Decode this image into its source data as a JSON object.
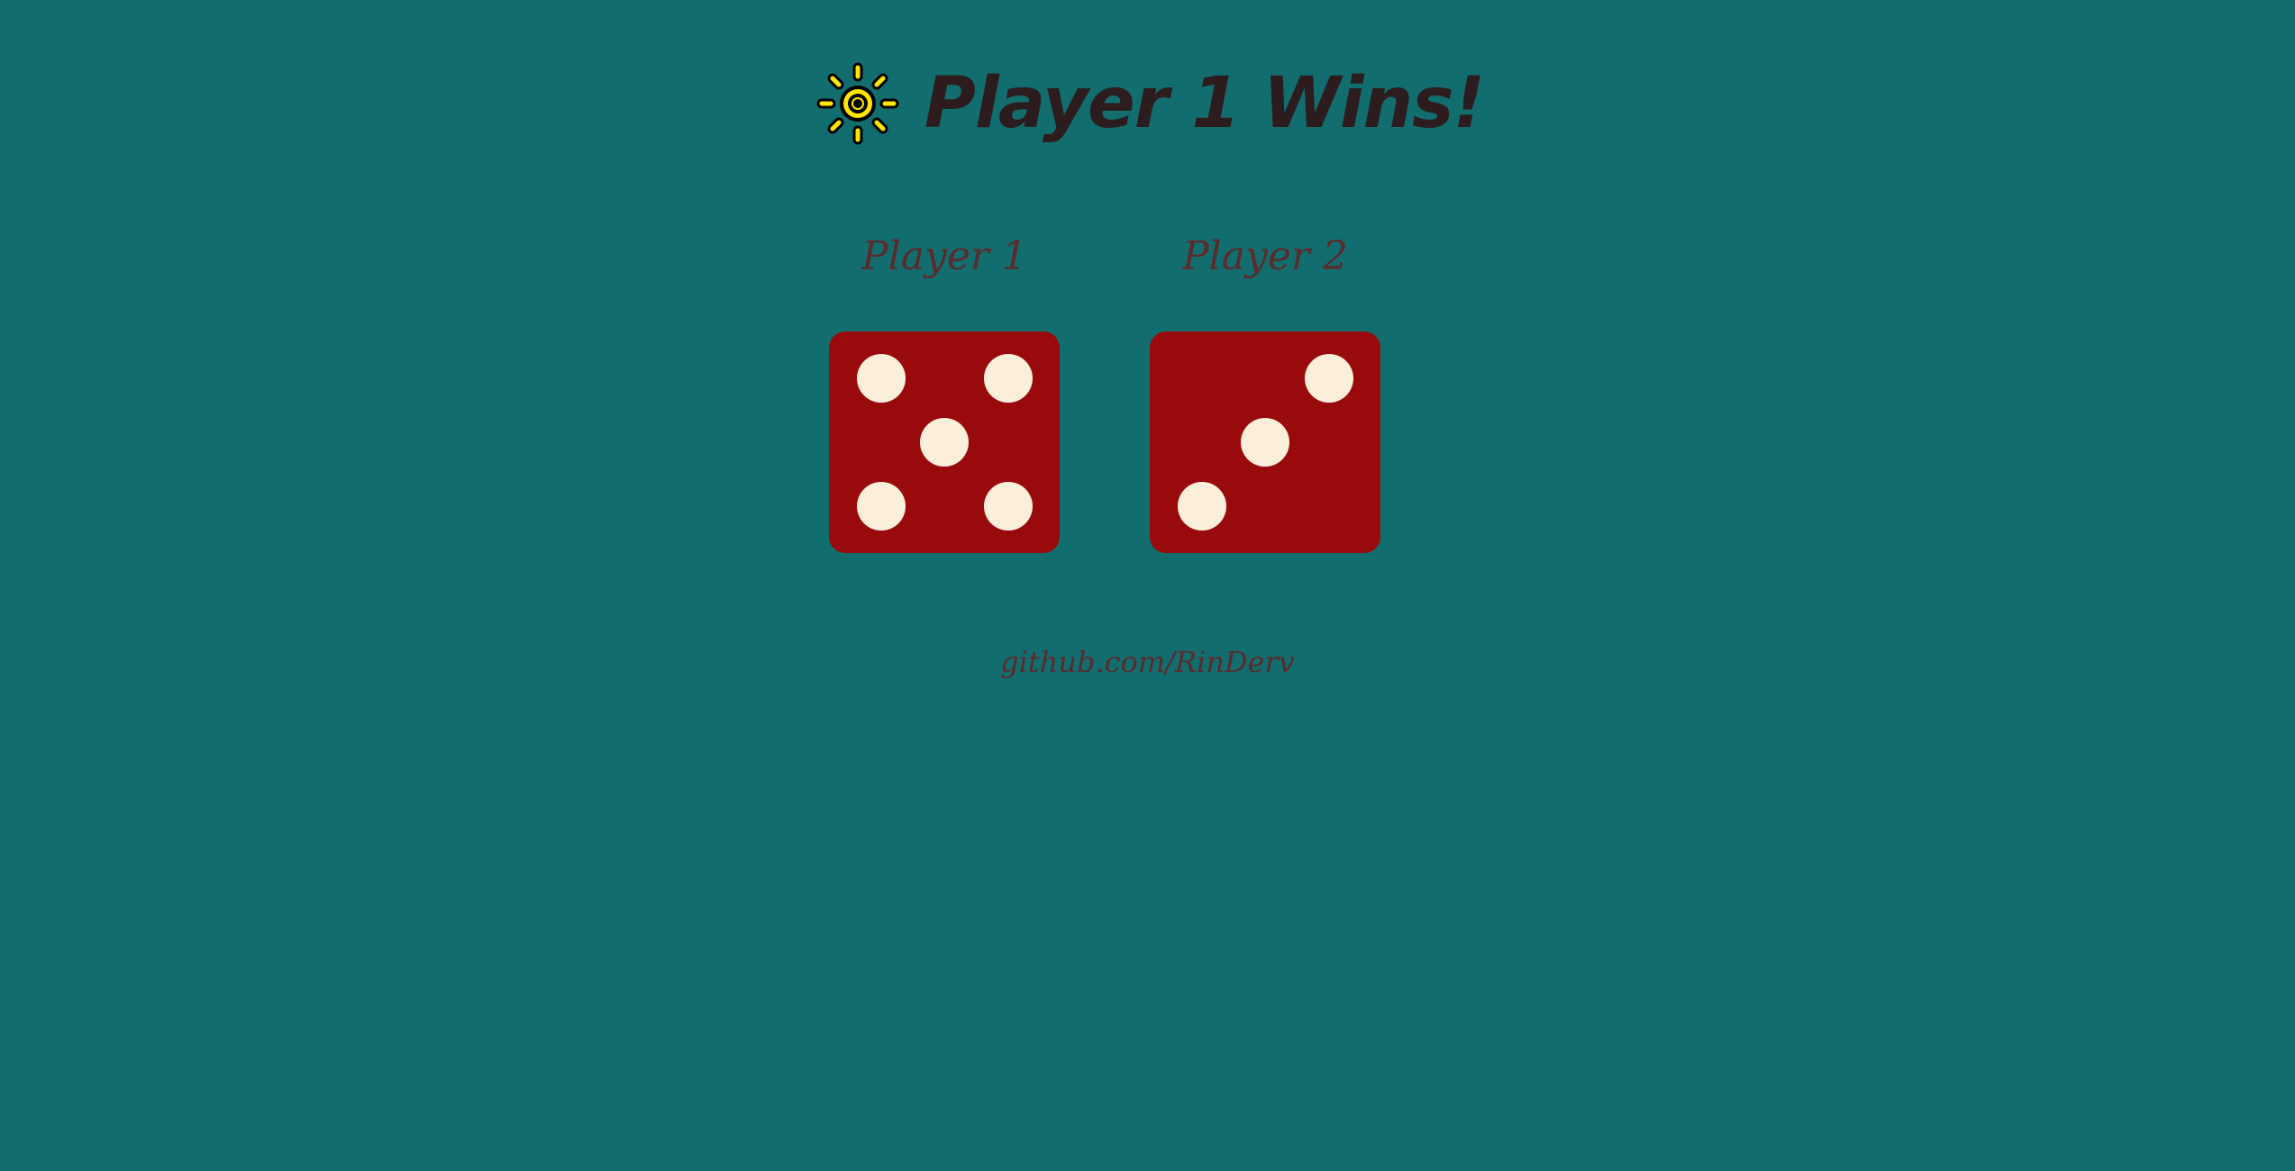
{
  "header": {
    "title": "Player 1 Wins!",
    "icon": "sun-icon"
  },
  "players": [
    {
      "label": "Player 1",
      "die_value": 5
    },
    {
      "label": "Player 2",
      "die_value": 3
    }
  ],
  "footer": {
    "link_text": "github.com/RinDerv"
  },
  "colors": {
    "background": "#126d6e",
    "die_face": "#990a0d",
    "pip": "#fbefda",
    "title": "#2c1c1e",
    "label": "#5a2a2c",
    "sun_fill": "#ffe600",
    "sun_stroke": "#000000"
  }
}
